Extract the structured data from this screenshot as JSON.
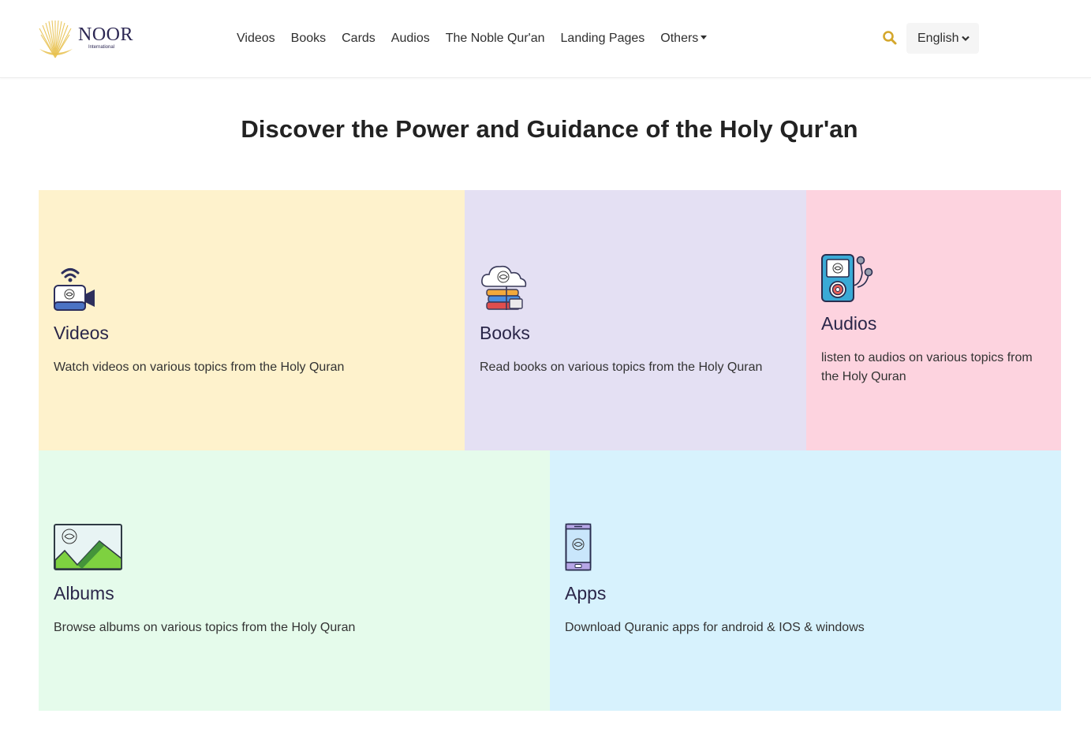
{
  "header": {
    "logo": {
      "name": "NOOR",
      "sub": "International"
    },
    "nav": {
      "items": [
        {
          "label": "Videos"
        },
        {
          "label": "Books"
        },
        {
          "label": "Cards"
        },
        {
          "label": "Audios"
        },
        {
          "label": "The Noble Qur'an"
        },
        {
          "label": "Landing Pages"
        },
        {
          "label": "Others"
        }
      ]
    },
    "search_icon": "search-icon",
    "language": {
      "selected": "English"
    }
  },
  "main": {
    "title": "Discover the Power and Guidance of the Holy Qur'an",
    "cards": [
      {
        "title": "Videos",
        "description": "Watch videos on various topics from the Holy Quran",
        "icon": "video-camera-icon",
        "color": "#fef2cc"
      },
      {
        "title": "Books",
        "description": "Read books on various topics from the Holy Quran",
        "icon": "books-cloud-icon",
        "color": "#e4e0f3"
      },
      {
        "title": "Audios",
        "description": "listen to audios on various topics from the Holy Quran",
        "icon": "audio-player-icon",
        "color": "#fdd3df"
      },
      {
        "title": "Albums",
        "description": "Browse albums on various topics from the Holy Quran",
        "icon": "album-picture-icon",
        "color": "#e5fbeb"
      },
      {
        "title": "Apps",
        "description": "Download Quranic apps for android & IOS & windows",
        "icon": "phone-app-icon",
        "color": "#d7f2fd"
      }
    ]
  },
  "colors": {
    "brand": "#2c2753",
    "logo_gold": "#e8c14f",
    "search_gold": "#d4a72c"
  }
}
